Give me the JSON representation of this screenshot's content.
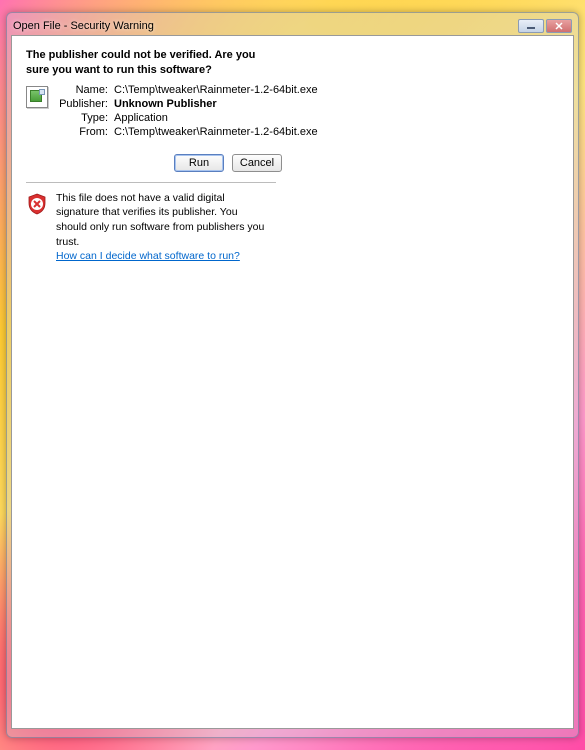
{
  "window": {
    "title": "Open File - Security Warning"
  },
  "heading": "The publisher could not be verified.  Are you sure you want to run this software?",
  "fields": {
    "name_label": "Name:",
    "name_value": "C:\\Temp\\tweaker\\Rainmeter-1.2-64bit.exe",
    "publisher_label": "Publisher:",
    "publisher_value": "Unknown Publisher",
    "type_label": "Type:",
    "type_value": "Application",
    "from_label": "From:",
    "from_value": "C:\\Temp\\tweaker\\Rainmeter-1.2-64bit.exe"
  },
  "buttons": {
    "run": "Run",
    "cancel": "Cancel"
  },
  "warning": {
    "text": "This file does not have a valid digital signature that verifies its publisher.  You should only run software from publishers you trust.",
    "link": "How can I decide what software to run?"
  }
}
